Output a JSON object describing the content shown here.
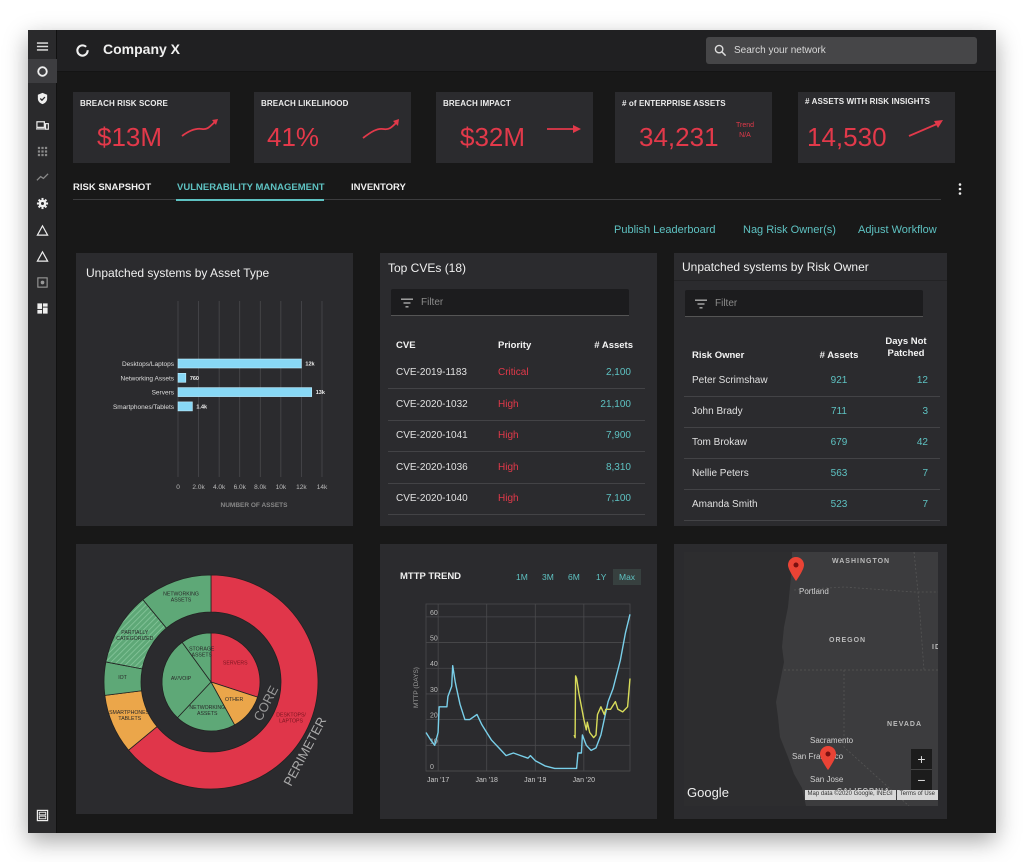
{
  "app": {
    "title": "Company X",
    "search_placeholder": "Search your network"
  },
  "sidebar": {
    "items": [
      {
        "icon": "menu-icon",
        "label": "Menu"
      },
      {
        "icon": "ring-icon",
        "label": "Dashboard",
        "active": true
      },
      {
        "icon": "shield-icon",
        "label": "Security"
      },
      {
        "icon": "devices-icon",
        "label": "Devices"
      },
      {
        "icon": "grid-icon",
        "label": "Apps"
      },
      {
        "icon": "trending-icon",
        "label": "Trends"
      },
      {
        "icon": "gear-icon",
        "label": "Settings"
      },
      {
        "icon": "triangle-icon",
        "label": "Alerts"
      },
      {
        "icon": "triangle-icon",
        "label": "Warnings"
      },
      {
        "icon": "chip-icon",
        "label": "Hardware"
      },
      {
        "icon": "dashboard-icon",
        "label": "Widgets"
      }
    ],
    "bottom_icon": "panel-icon"
  },
  "kpis": [
    {
      "label": "BREACH RISK SCORE",
      "value": "$13M",
      "trend": "up-curve"
    },
    {
      "label": "BREACH LIKELIHOOD",
      "value": "41%",
      "trend": "up-curve"
    },
    {
      "label": "BREACH IMPACT",
      "value": "$32M",
      "trend": "flat"
    },
    {
      "label": "# of ENTERPRISE ASSETS",
      "value": "34,231",
      "trend": "na",
      "trend_text_1": "Trend",
      "trend_text_2": "N/A"
    },
    {
      "label": "# ASSETS WITH RISK INSIGHTS",
      "value": "14,530",
      "trend": "up"
    }
  ],
  "tabs": [
    {
      "label": "RISK SNAPSHOT",
      "active": false
    },
    {
      "label": "VULNERABILITY MANAGEMENT",
      "active": true
    },
    {
      "label": "INVENTORY",
      "active": false
    }
  ],
  "actions": [
    "Publish Leaderboard",
    "Nag Risk Owner(s)",
    "Adjust Workflow"
  ],
  "colors": {
    "accent": "#5ec2c2",
    "danger": "#e2394a",
    "bar": "#88d8f5",
    "green": "#5ea877",
    "orange": "#eba64a",
    "yellow_line": "#d8dc5a",
    "blue_line": "#79cfe9"
  },
  "asset_type_card": {
    "title": "Unpatched systems by Asset Type"
  },
  "cve_card": {
    "title": "Top CVEs (18)",
    "filter_placeholder": "Filter",
    "columns": [
      "CVE",
      "Priority",
      "# Assets"
    ],
    "rows": [
      [
        "CVE-2019-1183",
        "Critical",
        "2,100"
      ],
      [
        "CVE-2020-1032",
        "High",
        "21,100"
      ],
      [
        "CVE-2020-1041",
        "High",
        "7,900"
      ],
      [
        "CVE-2020-1036",
        "High",
        "8,310"
      ],
      [
        "CVE-2020-1040",
        "High",
        "7,100"
      ]
    ]
  },
  "owner_card": {
    "title": "Unpatched systems by Risk Owner",
    "filter_placeholder": "Filter",
    "columns": [
      "Risk Owner",
      "# Assets",
      "Days Not Patched"
    ],
    "rows": [
      [
        "Peter Scrimshaw",
        "921",
        "12"
      ],
      [
        "John Brady",
        "711",
        "3"
      ],
      [
        "Tom Brokaw",
        "679",
        "42"
      ],
      [
        "Nellie Peters",
        "563",
        "7"
      ],
      [
        "Amanda Smith",
        "523",
        "7"
      ]
    ]
  },
  "mttp_card": {
    "title": "MTTP TREND",
    "ranges": [
      "1M",
      "3M",
      "6M",
      "1Y",
      "Max"
    ],
    "active_range": "Max"
  },
  "map_card": {
    "states": [
      "WASHINGTON",
      "OREGON",
      "NEVADA",
      "CALIFORNIA",
      "ID"
    ],
    "cities": [
      "Portland",
      "Sacramento",
      "San Francisco",
      "San Jose"
    ],
    "markers": [
      "Portland",
      "San Jose"
    ],
    "zoom_in": "+",
    "zoom_out": "−",
    "attribution": "Map data ©2020 Google, INEGI",
    "terms": "Terms of Use",
    "provider": "Google"
  },
  "chart_data": [
    {
      "type": "bar",
      "orientation": "horizontal",
      "title": "Unpatched systems by Asset Type",
      "categories": [
        "Desktops/Laptops",
        "Networking Assets",
        "Servers",
        "Smartphones/Tablets"
      ],
      "values": [
        12000,
        760,
        13000,
        1400
      ],
      "data_labels": [
        "12k",
        "760",
        "13k",
        "1.4k"
      ],
      "xlabel": "NUMBER OF ASSETS",
      "ylabel": "",
      "xlim": [
        0,
        14000
      ],
      "xticks": [
        "0",
        "2.0k",
        "4.0k",
        "6.0k",
        "8.0k",
        "10k",
        "12k",
        "14k"
      ],
      "grid": true
    },
    {
      "type": "pie",
      "subtype": "sunburst",
      "rings": [
        {
          "name": "CORE",
          "slices": [
            {
              "label": "SERVERS",
              "value": 30,
              "color": "red"
            },
            {
              "label": "OTHER",
              "value": 12,
              "color": "orange"
            },
            {
              "label": "NETWORKING ASSETS",
              "value": 20,
              "color": "green"
            },
            {
              "label": "AV/VOIP",
              "value": 28,
              "color": "green"
            },
            {
              "label": "STORAGE ASSETS",
              "value": 10,
              "color": "green"
            }
          ]
        },
        {
          "name": "PERIMETER",
          "slices": [
            {
              "label": "DESKTOPS/ LAPTOPS",
              "value": 64,
              "color": "red"
            },
            {
              "label": "SMARTPHONES/ TABLETS",
              "value": 9,
              "color": "orange"
            },
            {
              "label": "IOT",
              "value": 5,
              "color": "green"
            },
            {
              "label": "PARTIALLY CATEGORIZED",
              "value": 11,
              "color": "green-hatched"
            },
            {
              "label": "NETWORKING ASSETS",
              "value": 11,
              "color": "green"
            }
          ]
        }
      ]
    },
    {
      "type": "line",
      "title": "MTTP TREND",
      "ylabel": "MTTP (DAYS)",
      "xlabel": "",
      "ylim": [
        0,
        65
      ],
      "yticks": [
        0,
        10,
        20,
        30,
        40,
        50,
        60
      ],
      "xticks": [
        "Jan '17",
        "Jan '18",
        "Jan '19",
        "Jan '20"
      ],
      "xlim": [
        2016.75,
        2020.95
      ],
      "grid": true,
      "series": [
        {
          "name": "blue",
          "x": [
            2016.75,
            2016.85,
            2016.93,
            2017.0,
            2017.02,
            2017.18,
            2017.2,
            2017.28,
            2017.3,
            2017.35,
            2017.37,
            2017.45,
            2017.55,
            2017.65,
            2017.8,
            2017.9,
            2018.0,
            2018.1,
            2018.25,
            2018.4,
            2018.55,
            2018.7,
            2018.85,
            2018.9,
            2019.0,
            2019.2,
            2019.4,
            2019.6,
            2019.85,
            2019.88,
            2019.95,
            2019.97,
            2020.05,
            2020.15,
            2020.25,
            2020.35,
            2020.5,
            2020.6,
            2020.75,
            2020.85,
            2020.86,
            2020.95
          ],
          "y": [
            15,
            12,
            10,
            15,
            25,
            25,
            29,
            33,
            41,
            35,
            33,
            26,
            20,
            20,
            22,
            18,
            15,
            12,
            9,
            6,
            7,
            6,
            5,
            6,
            4,
            2,
            1,
            1,
            1,
            7,
            7,
            14,
            10,
            8,
            9,
            14,
            27,
            32,
            43,
            53,
            54,
            61
          ]
        },
        {
          "name": "yellow",
          "x": [
            2019.8,
            2019.82,
            2019.83,
            2019.85,
            2019.9,
            2020.0,
            2020.05,
            2020.07,
            2020.12,
            2020.2,
            2020.25,
            2020.28,
            2020.35,
            2020.42,
            2020.45,
            2020.55,
            2020.65,
            2020.7,
            2020.8,
            2020.9,
            2020.95
          ],
          "y": [
            14,
            13,
            37,
            36,
            30,
            20,
            16,
            19,
            15,
            13,
            14,
            22,
            25,
            22,
            24,
            24,
            27,
            24,
            23,
            25,
            36
          ]
        }
      ]
    }
  ]
}
